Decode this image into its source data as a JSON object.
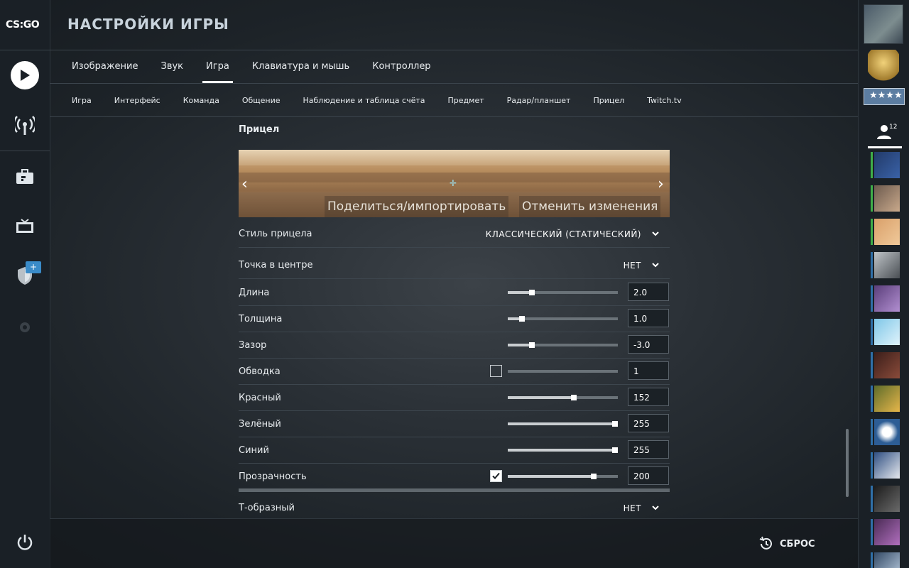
{
  "app": {
    "logo_text": "CS:GO",
    "title": "НАСТРОЙКИ ИГРЫ"
  },
  "main_tabs": [
    {
      "label": "Изображение",
      "active": false
    },
    {
      "label": "Звук",
      "active": false
    },
    {
      "label": "Игра",
      "active": true
    },
    {
      "label": "Клавиатура и мышь",
      "active": false
    },
    {
      "label": "Контроллер",
      "active": false
    }
  ],
  "sub_tabs": [
    {
      "label": "Игра"
    },
    {
      "label": "Интерфейс"
    },
    {
      "label": "Команда"
    },
    {
      "label": "Общение"
    },
    {
      "label": "Наблюдение и таблица счёта"
    },
    {
      "label": "Предмет"
    },
    {
      "label": "Радар/планшет"
    },
    {
      "label": "Прицел"
    },
    {
      "label": "Twitch.tv"
    }
  ],
  "section": {
    "title": "Прицел",
    "preview_share": "Поделиться/импортировать",
    "preview_revert": "Отменить изменения"
  },
  "settings": {
    "style": {
      "label": "Стиль прицела",
      "value": "КЛАССИЧЕСКИЙ (СТАТИЧЕСКИЙ)"
    },
    "center_dot": {
      "label": "Точка в центре",
      "value": "НЕТ"
    },
    "length": {
      "label": "Длина",
      "value": "2.0",
      "level": 0.22
    },
    "thickness": {
      "label": "Толщина",
      "value": "1.0",
      "level": 0.13
    },
    "gap": {
      "label": "Зазор",
      "value": "-3.0",
      "level": 0.22
    },
    "outline": {
      "label": "Обводка",
      "value": "1",
      "checked": false,
      "level": 0.0
    },
    "red": {
      "label": "Красный",
      "value": "152",
      "level": 0.6
    },
    "green": {
      "label": "Зелёный",
      "value": "255",
      "level": 1.0
    },
    "blue": {
      "label": "Синий",
      "value": "255",
      "level": 1.0
    },
    "alpha": {
      "label": "Прозрачность",
      "value": "200",
      "checked": true,
      "level": 0.78
    },
    "t_style": {
      "label": "Т-образный",
      "value": "НЕТ"
    }
  },
  "footer": {
    "reset_label": "СБРОС"
  },
  "friends": {
    "count": "12"
  },
  "colors": {
    "accent_green": "#3fae49",
    "accent_blue": "#2f6fa8",
    "badge_blue": "#3a8bc8"
  },
  "icons": [
    "play-icon",
    "antenna-icon",
    "briefcase-icon",
    "tv-icon",
    "shield-icon",
    "gear-icon",
    "power-icon",
    "reset-icon",
    "friends-icon",
    "chevron-left-icon",
    "chevron-right-icon",
    "chevron-down-icon"
  ]
}
